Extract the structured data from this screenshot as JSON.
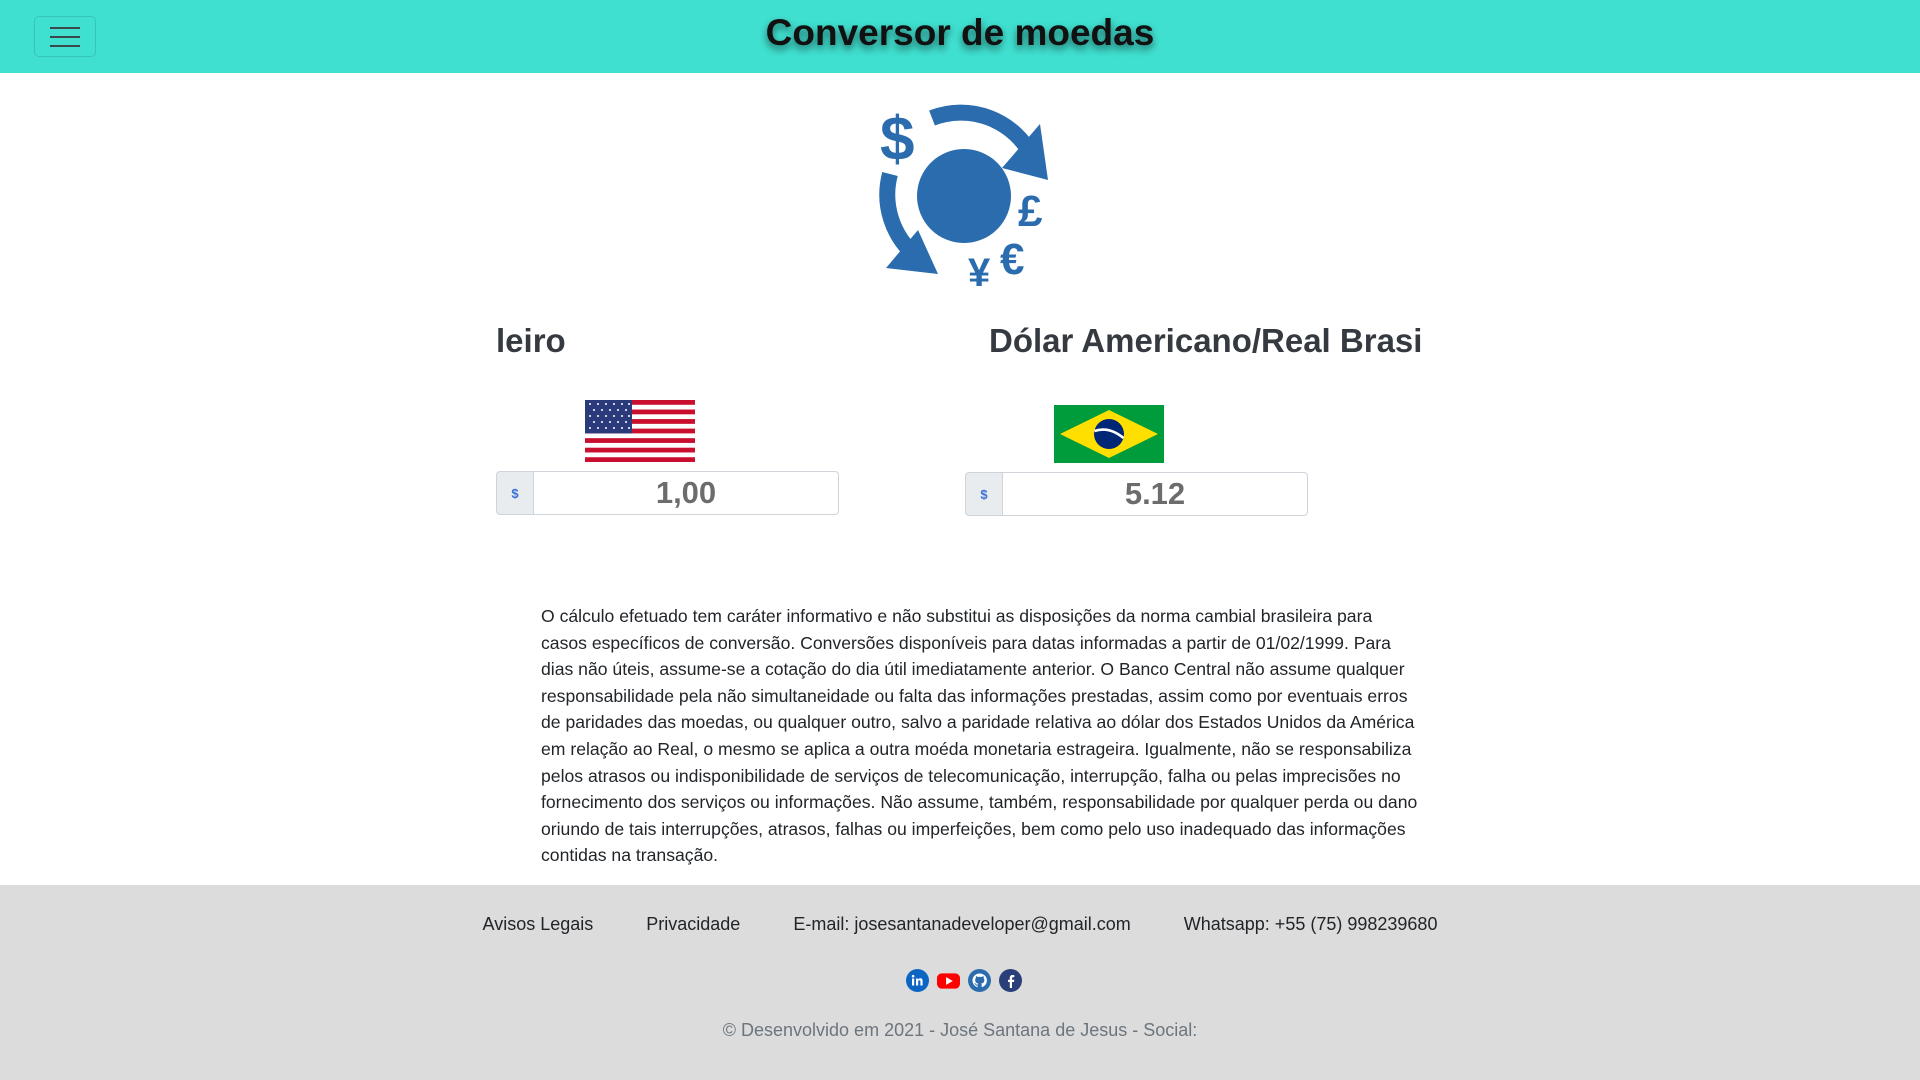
{
  "header": {
    "title": "Conversor de moedas",
    "menu_icon": "hamburger-icon",
    "background": "#40e0d0"
  },
  "logo": {
    "icon": "currency-exchange-icon",
    "color": "#2a6cae"
  },
  "converter": {
    "left": {
      "title": "leiro",
      "flag_icon": "usa-flag-icon",
      "currency_symbol": "$",
      "value": "1,00"
    },
    "right": {
      "title": "Dólar Americano/Real Brasi",
      "flag_icon": "brazil-flag-icon",
      "currency_symbol": "$",
      "value": "5.12"
    }
  },
  "disclaimer": "O cálculo efetuado tem caráter informativo e não substitui as disposições da norma cambial brasileira para casos específicos de conversão. Conversões disponíveis para datas informadas a partir de 01/02/1999. Para dias não úteis, assume-se a cotação do dia útil imediatamente anterior. O Banco Central não assume qualquer responsabilidade pela não simultaneidade ou falta das informações prestadas, assim como por eventuais erros de paridades das moedas, ou qualquer outro, salvo a paridade relativa ao dólar dos Estados Unidos da América em relação ao Real, o mesmo se aplica a outra moéda monetaria estrageira. Igualmente, não se responsabiliza pelos atrasos ou indisponibilidade de serviços de telecomunicação, interrupção, falha ou pelas imprecisões no fornecimento dos serviços ou informações. Não assume, também, responsabilidade por qualquer perda ou dano oriundo de tais interrupções, atrasos, falhas ou imperfeições, bem como pelo uso inadequado das informações contidas na transação.",
  "footer": {
    "links": {
      "legal": "Avisos Legais",
      "privacy": "Privacidade",
      "email": "E-mail: josesantanadeveloper@gmail.com",
      "whatsapp": "Whatsapp: +55 (75) 998239680"
    },
    "social": [
      "linkedin-icon",
      "youtube-icon",
      "github-icon",
      "facebook-icon"
    ],
    "copyright": "© Desenvolvido em 2021 - José Santana de Jesus - Social:",
    "background": "#dcdcdc"
  }
}
